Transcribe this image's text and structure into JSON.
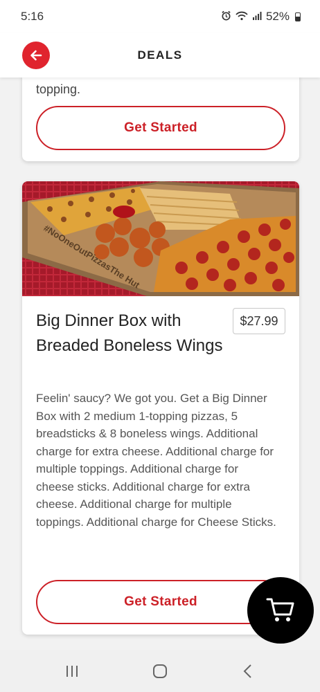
{
  "status_bar": {
    "time": "5:16",
    "battery": "52%",
    "icons": [
      "alarm-icon",
      "wifi-icon",
      "signal-icon",
      "battery-icon"
    ]
  },
  "header": {
    "title": "DEALS",
    "back_icon": "arrow-left-icon",
    "accent_color": "#e0242e"
  },
  "previous_deal": {
    "description_tail": "topping.",
    "cta_label": "Get Started"
  },
  "deal": {
    "title": "Big Dinner Box with Breaded Boneless Wings",
    "price": "$27.99",
    "description": "Feelin' saucy? We got you. Get a Big Dinner Box with 2 medium 1-topping pizzas, 5 breadsticks & 8 boneless wings. Additional charge for extra cheese. Additional charge for multiple toppings. Additional charge for cheese sticks. Additional charge for extra cheese. Additional charge for multiple toppings. Additional charge for Cheese Sticks.",
    "image_box_text": "#NoOneOutPizzasThe Hut",
    "cta_label": "Get Started",
    "cta_color": "#cc2027"
  },
  "cart": {
    "icon": "cart-icon"
  },
  "nav": {
    "icons": [
      "recent-apps-icon",
      "home-icon",
      "back-icon"
    ]
  }
}
